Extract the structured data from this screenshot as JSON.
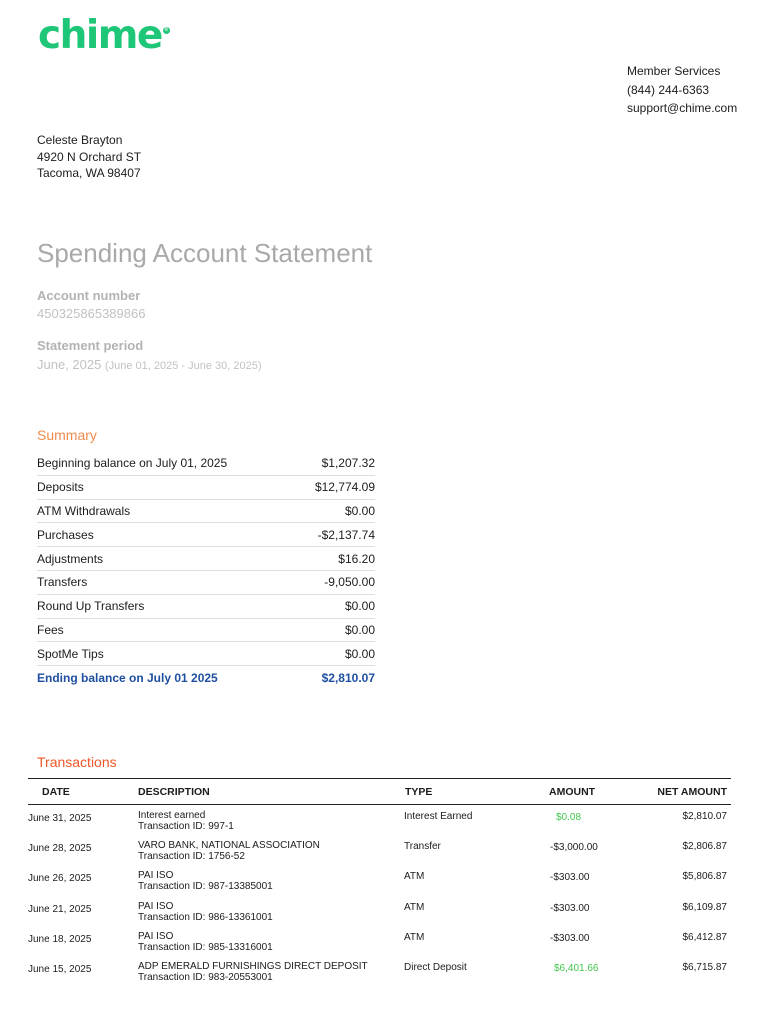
{
  "colors": {
    "brand_green": "#1ec677",
    "summary_orange": "#ef8c4c",
    "transactions_red": "#ee5626",
    "ending_blue": "#1f4fa0",
    "positive_green": "#43c64d",
    "muted_gray": "#b3b3b3"
  },
  "logo": {
    "text": "chime",
    "mark": "®"
  },
  "member_services": {
    "title": "Member Services",
    "phone": "(844) 244-6363",
    "email": "support@chime.com"
  },
  "address": {
    "name": "Celeste Brayton",
    "street": "4920 N Orchard ST",
    "city": "Tacoma, WA 98407"
  },
  "statement": {
    "title": "Spending Account Statement",
    "account_number_label": "Account number",
    "account_number": "450325865389866",
    "period_label": "Statement period",
    "period_month": "June, 2025",
    "period_range": "(June 01, 2025 - June 30, 2025)"
  },
  "summary": {
    "title": "Summary",
    "rows": [
      {
        "label": "Beginning balance on July 01, 2025",
        "value": "$1,207.32"
      },
      {
        "label": "Deposits",
        "value": "$12,774.09"
      },
      {
        "label": "ATM Withdrawals",
        "value": "$0.00"
      },
      {
        "label": "Purchases",
        "value": "-$2,137.74"
      },
      {
        "label": "Adjustments",
        "value": "$16.20"
      },
      {
        "label": "Transfers",
        "value": "-9,050.00"
      },
      {
        "label": "Round Up Transfers",
        "value": "$0.00"
      },
      {
        "label": "Fees",
        "value": "$0.00"
      },
      {
        "label": "SpotMe Tips",
        "value": "$0.00"
      }
    ],
    "ending": {
      "label": "Ending balance on July 01 2025",
      "value": "$2,810.07"
    }
  },
  "transactions": {
    "title": "Transactions",
    "headers": [
      "DATE",
      "DESCRIPTION",
      "TYPE",
      "AMOUNT",
      "NET AMOUNT"
    ],
    "rows": [
      {
        "date": "June 31, 2025",
        "desc": "Interest earned",
        "txid": "Transaction ID: 997-1",
        "type": "Interest Earned",
        "amount": "$0.08",
        "net": "$2,810.07",
        "positive": true
      },
      {
        "date": "June 28, 2025",
        "desc": "VARO BANK, NATIONAL ASSOCIATION",
        "txid": "Transaction ID: 1756-52",
        "type": "Transfer",
        "amount": "-$3,000.00",
        "net": "$2,806.87",
        "positive": false
      },
      {
        "date": "June 26, 2025",
        "desc": "PAI ISO",
        "txid": "Transaction ID: 987-13385001",
        "type": "ATM",
        "amount": "-$303.00",
        "net": "$5,806.87",
        "positive": false
      },
      {
        "date": "June 21, 2025",
        "desc": "PAI ISO",
        "txid": "Transaction ID: 986-13361001",
        "type": "ATM",
        "amount": "-$303.00",
        "net": "$6,109.87",
        "positive": false
      },
      {
        "date": "June 18, 2025",
        "desc": "PAI ISO",
        "txid": "Transaction ID: 985-13316001",
        "type": "ATM",
        "amount": "-$303.00",
        "net": "$6,412.87",
        "positive": false
      },
      {
        "date": "June 15, 2025",
        "desc": "ADP EMERALD FURNISHINGS DIRECT DEPOSIT",
        "txid": "Transaction ID: 983-20553001",
        "type": "Direct Deposit",
        "amount": "$6,401.66",
        "net": "$6,715.87",
        "positive": true
      }
    ]
  }
}
